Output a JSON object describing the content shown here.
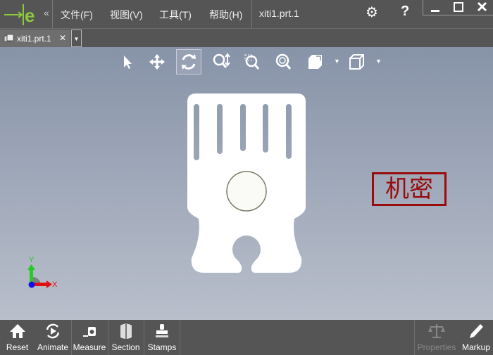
{
  "titlebar": {
    "menus": [
      "文件(F)",
      "视图(V)",
      "工具(T)",
      "帮助(H)"
    ],
    "doc_title": "xiti1.prt.1",
    "collapse": "«"
  },
  "tabs": [
    {
      "label": "xiti1.prt.1",
      "close": "✕"
    }
  ],
  "view_toolbar": [
    "select-icon",
    "pan-icon",
    "rotate-icon",
    "zoom-icon",
    "zoom-window-icon",
    "zoom-fit-icon",
    "view-orientation-icon",
    "display-mode-icon"
  ],
  "stamp": {
    "text": "机密",
    "color": "#9a0b0b"
  },
  "triad": {
    "x": "X",
    "y": "Y"
  },
  "bottom": {
    "left": [
      "Reset",
      "Animate",
      "Measure",
      "Section",
      "Stamps"
    ],
    "right": [
      "Properties",
      "Markup"
    ]
  },
  "colors": {
    "accent": "#8dc63f"
  }
}
